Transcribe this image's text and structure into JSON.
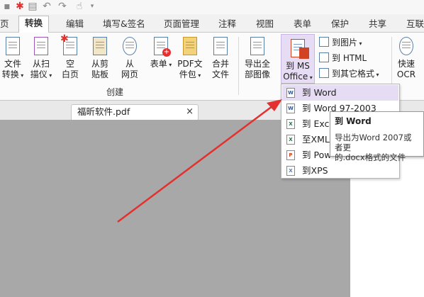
{
  "ribbon_tabs": [
    "页",
    "转换",
    "编辑",
    "填写&签名",
    "页面管理",
    "注释",
    "视图",
    "表单",
    "保护",
    "共享",
    "互联"
  ],
  "active_tab": "转换",
  "create_group": {
    "label": "创建",
    "buttons": [
      {
        "line1": "文件",
        "line2": "转换"
      },
      {
        "line1": "从扫",
        "line2": "描仪"
      },
      {
        "line1": "空",
        "line2": "白页"
      },
      {
        "line1": "从剪",
        "line2": "贴板"
      },
      {
        "line1": "从",
        "line2": "网页"
      },
      {
        "line1": "表单",
        "line2": ""
      },
      {
        "line1": "PDF文",
        "line2": "件包"
      },
      {
        "line1": "合并",
        "line2": "文件"
      }
    ]
  },
  "export_all": {
    "line1": "导出全",
    "line2": "部图像"
  },
  "to_ms_office": {
    "line1": "到 MS",
    "line2": "Office"
  },
  "small_buttons": [
    "到图片",
    "到 HTML",
    "到其它格式"
  ],
  "ocr": {
    "line1": "快速",
    "line2": "OCR"
  },
  "doc_tab": {
    "title": "福昕软件.pdf",
    "close": "×"
  },
  "dropdown_items": [
    {
      "label": "到 Word",
      "icon_letter": "W",
      "icon_color": "#2b579a"
    },
    {
      "label": "到 Word 97-2003",
      "icon_letter": "W",
      "icon_color": "#2b579a"
    },
    {
      "label": "到 Excel",
      "icon_letter": "X",
      "icon_color": "#217346"
    },
    {
      "label": "至XMLE",
      "icon_letter": "X",
      "icon_color": "#217346"
    },
    {
      "label": "到 Pow",
      "icon_letter": "P",
      "icon_color": "#d04423"
    },
    {
      "label": "到XPS",
      "icon_letter": "X",
      "icon_color": "#5a7fa8"
    }
  ],
  "tooltip": {
    "title": "到 Word",
    "body": "导出为Word 2007或者更\n的.docx格式的文件"
  },
  "colors": {
    "accent": "#e4302f",
    "hover": "#e6dcf3",
    "canvas": "#a8a8a8"
  }
}
